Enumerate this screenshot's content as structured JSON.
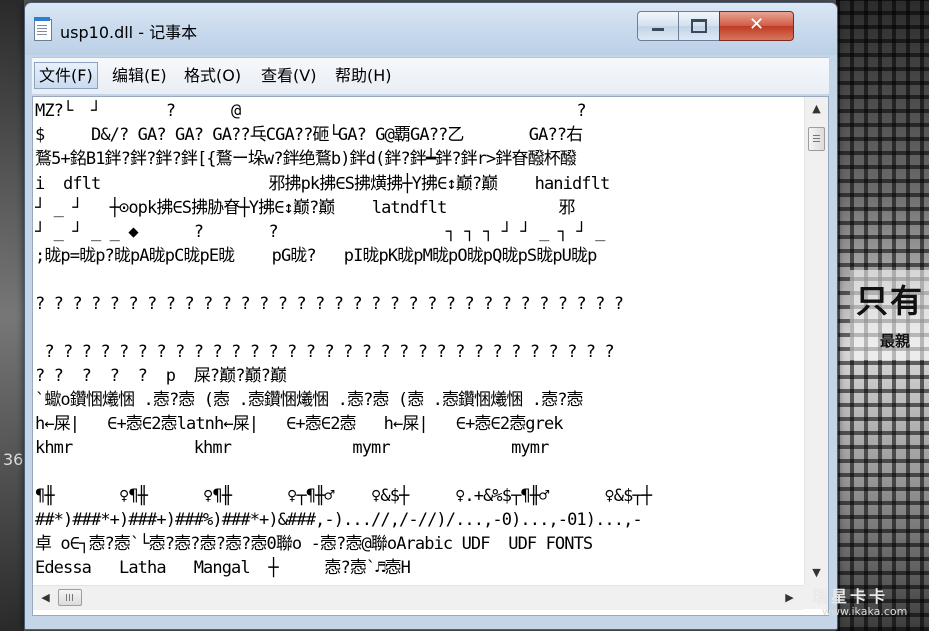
{
  "window": {
    "title": "usp10.dll - 记事本",
    "controls": {
      "minimize": "",
      "maximize": "",
      "close": "✕"
    }
  },
  "menu": {
    "items": [
      "文件(F)",
      "编辑(E)",
      "格式(O)",
      "查看(V)",
      "帮助(H)"
    ]
  },
  "editor": {
    "lines": [
      "MZ?└  ┘       ?      @                                    ?",
      "$     D&/? GA? GA? GA??乓CGA??砸└GA? G@覇GA??乙       GA??右",
      "鶩5+銘B1鉡?鉡?鉡?鉡[{鶩ー垛w?鉡绝鶩b)鉡d(鉡?鉡┷鉡?鉡r>鉡眘醱杯醱",
      "i  dflt                  邪拂pk拂∈S拂熿拂┼Y拂∈↕巅?巅    hanidflt",
      "┘ _ ┘   ┼⊙opk拂∈S拂胁眘┼Y拂∈↕巅?巅    latndflt            邪",
      "┘ _ ┘ _ _ ◆      ?       ?                  ┐ ┐ ┐ ┘ ┘ _ ┐ ┘ _",
      ";昽p=昽p?昽pA昽pC昽pE昽    pG昽?   pI昽pK昽pM昽pO昽pQ昽pS昽pU昽p",
      "",
      "? ? ? ? ? ? ? ? ? ? ? ? ? ? ? ? ? ? ? ? ? ? ? ? ? ? ? ? ? ? ? ?",
      "",
      " ? ? ? ? ? ? ? ? ? ? ? ? ? ? ? ? ? ? ? ? ? ? ? ? ? ? ? ? ? ? ?",
      "? ?  ?  ?  ?  p  屎?巅?巅?巅",
      "`蠍o鑽悃爔悃 .悫?悫 (悫 .悫鑽悃爔悃 .悫?悫 (悫 .悫鑽悃爔悃 .悫?悫",
      "h←屎|   ∈+悫∈2悫latnh←屎|   ∈+悫∈2悫   h←屎|   ∈+悫∈2悫grek",
      "khmr             khmr             mymr             mymr",
      "",
      "¶╫       ♀¶╫      ♀¶╫      ♀┬¶╫♂    ♀&$┼     ♀.+&%$┬¶╫♂      ♀&$┬┼",
      "##*)###*+)###+)###%)###*+)&###,-)...//,/-//)/...,-0)...,-01)...,-",
      "卓 o∈┐悫?悫`└悫?悫?悫?悫?悫0聯o -悫?悫@聯oArabic UDF  UDF FONTS",
      "Edessa   Latha   Mangal  ┼     悫?悫`♬悫H"
    ]
  },
  "scrollbars": {
    "up": "▲",
    "down": "▼",
    "left": "◀",
    "right": "▶"
  },
  "desktop": {
    "side_number": "36",
    "banner_big": "只有",
    "banner_small": "最親",
    "watermark_title": "瑞星卡卡",
    "watermark_url": "www.ikaka.com"
  }
}
